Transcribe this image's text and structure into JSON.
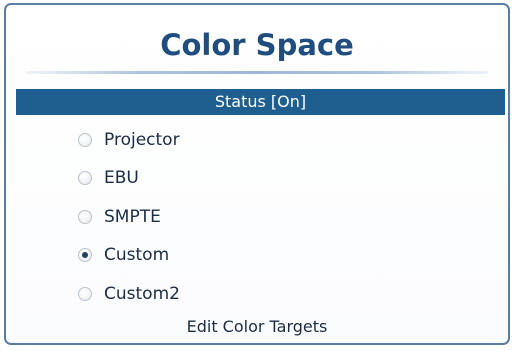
{
  "panel": {
    "title": "Color Space",
    "status_label": "Status [On]",
    "options": [
      {
        "label": "Projector",
        "checked": false
      },
      {
        "label": "EBU",
        "checked": false
      },
      {
        "label": "SMPTE",
        "checked": false
      },
      {
        "label": "Custom",
        "checked": true
      },
      {
        "label": "Custom2",
        "checked": false
      }
    ],
    "footer_link": "Edit Color Targets"
  },
  "colors": {
    "title": "#1f4d80",
    "status_bar": "#1f5f8f",
    "border": "#5a7da8"
  }
}
